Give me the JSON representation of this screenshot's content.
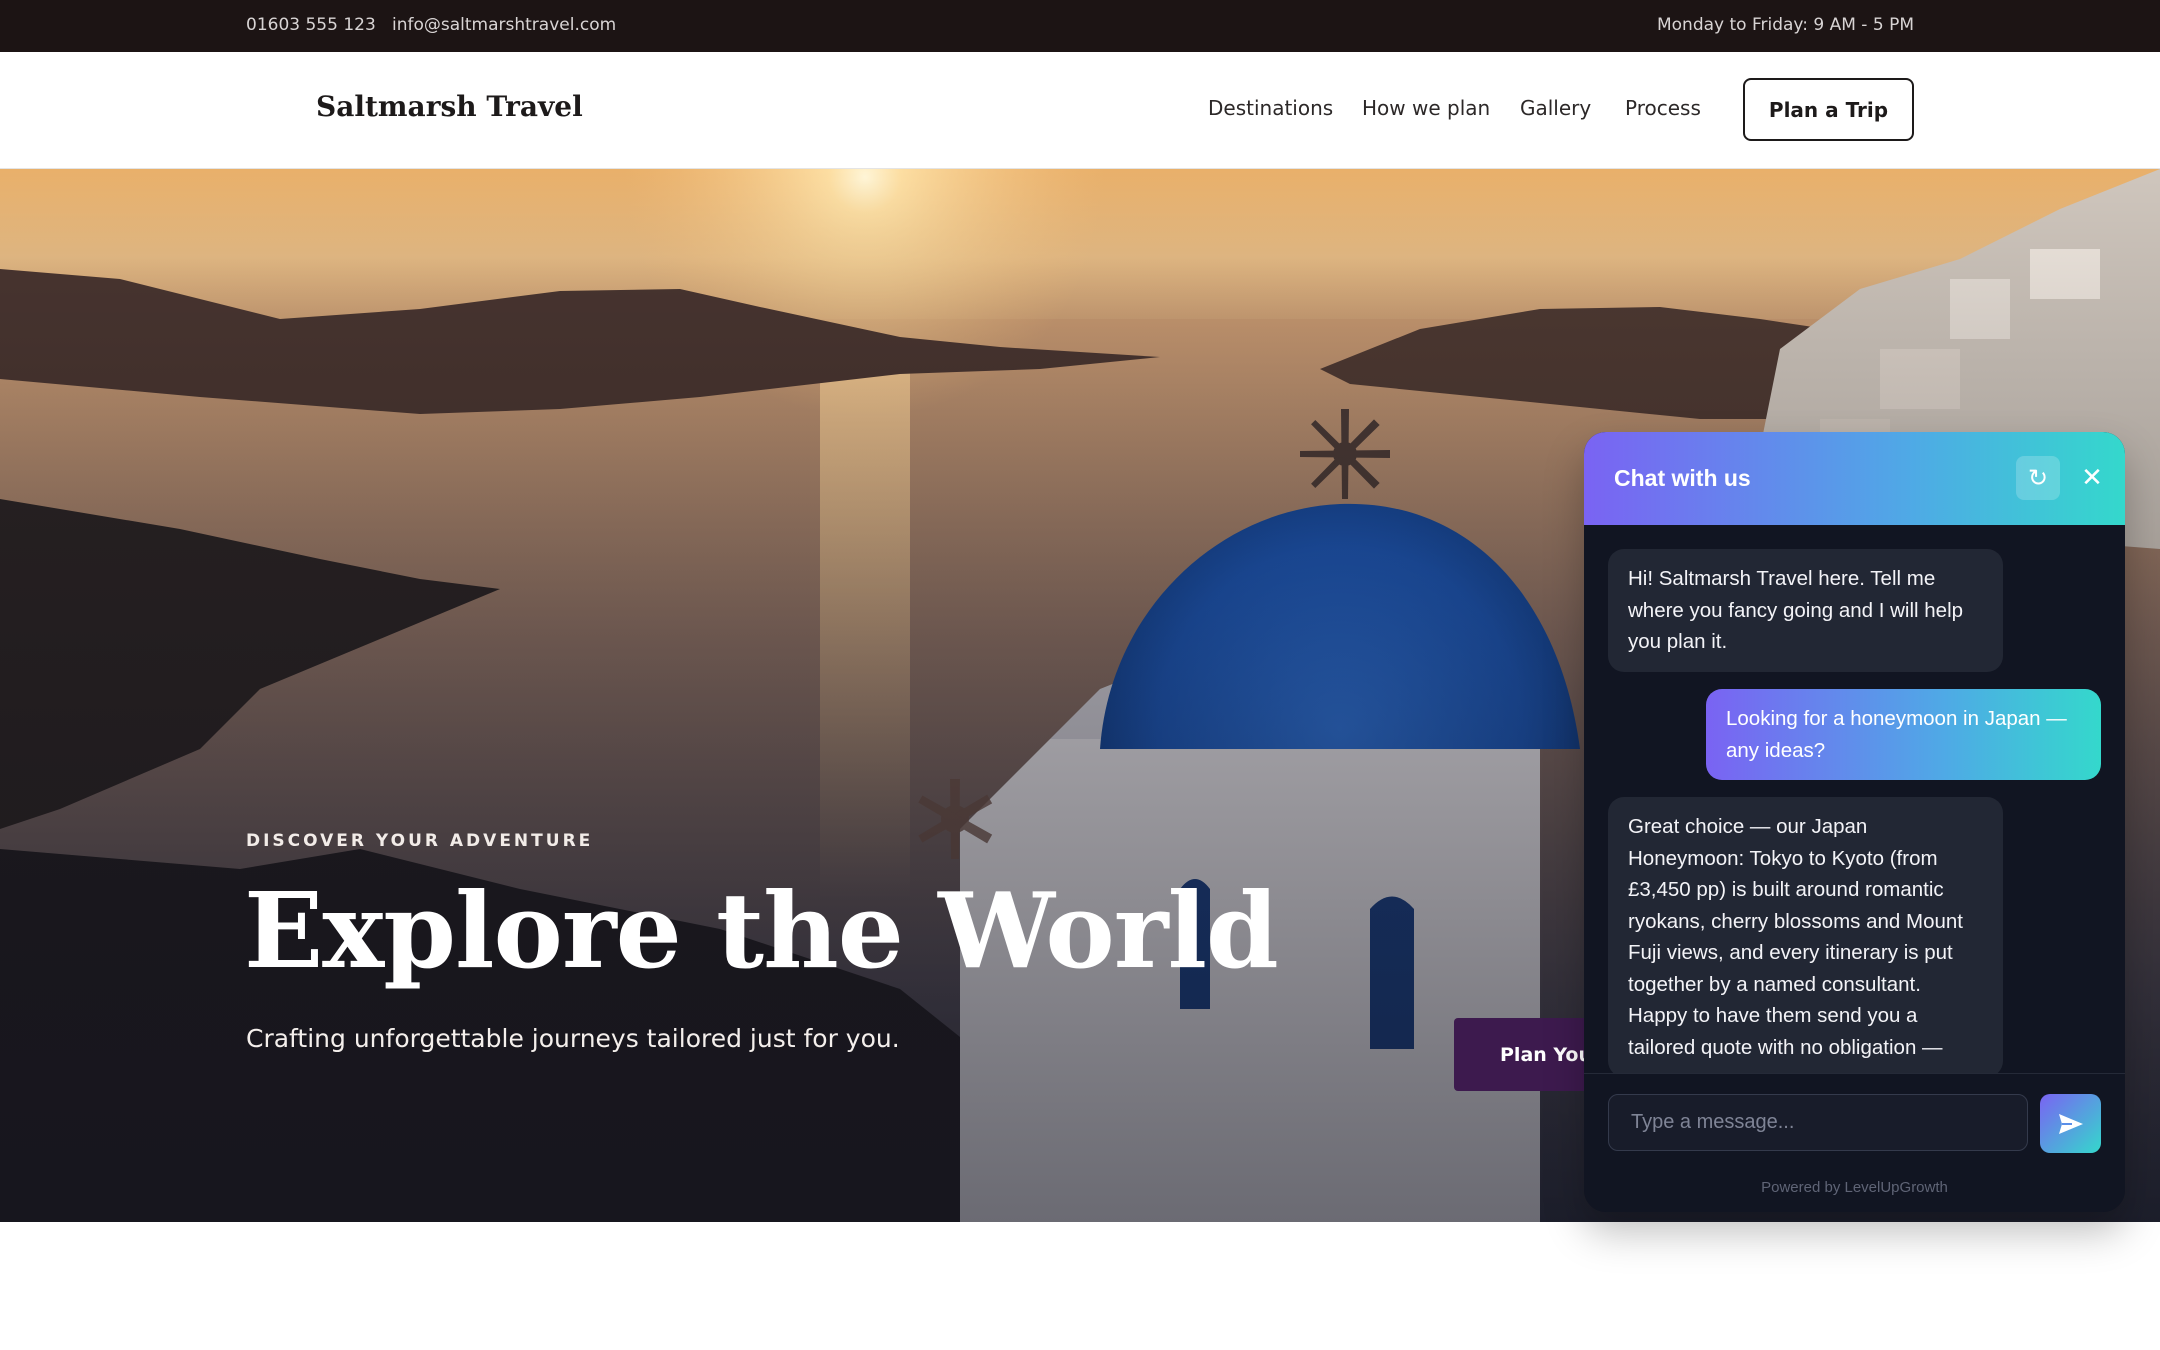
{
  "topbar": {
    "phone": "01603 555 123",
    "email": "info@saltmarshtravel.com",
    "hours": "Monday to Friday: 9 AM - 5 PM"
  },
  "header": {
    "brand": "Saltmarsh Travel",
    "nav": [
      "Destinations",
      "How we plan",
      "Gallery",
      "Process"
    ],
    "cta_label": "Plan a Trip"
  },
  "hero": {
    "eyebrow": "DISCOVER YOUR ADVENTURE",
    "title": "Explore the World",
    "subtitle": "Crafting unforgettable journeys tailored just for you.",
    "cta_label": "Plan Your"
  },
  "chat": {
    "title": "Chat with us",
    "refresh_icon": "refresh-icon",
    "close_icon": "close-icon",
    "messages": [
      {
        "role": "bot",
        "text": "Hi! Saltmarsh Travel here. Tell me where you fancy going and I will help you plan it."
      },
      {
        "role": "user",
        "text": "Looking for a honeymoon in Japan — any ideas?"
      },
      {
        "role": "bot",
        "text": "Great choice — our Japan Honeymoon: Tokyo to Kyoto (from £3,450 pp) is built around romantic ryokans, cherry blossoms and Mount Fuji views, and every itinerary is put together by a named consultant. Happy to have them send you a tailored quote with no obligation —"
      }
    ],
    "input_placeholder": "Type a message...",
    "send_icon": "send-icon",
    "powered_by": "Powered by LevelUpGrowth"
  },
  "colors": {
    "topbar_bg": "#1c1414",
    "cta_bg": "#3d1a4e",
    "chat_gradient_start": "#7a63f3",
    "chat_gradient_end": "#34d8cc",
    "chat_bg": "#111522"
  }
}
